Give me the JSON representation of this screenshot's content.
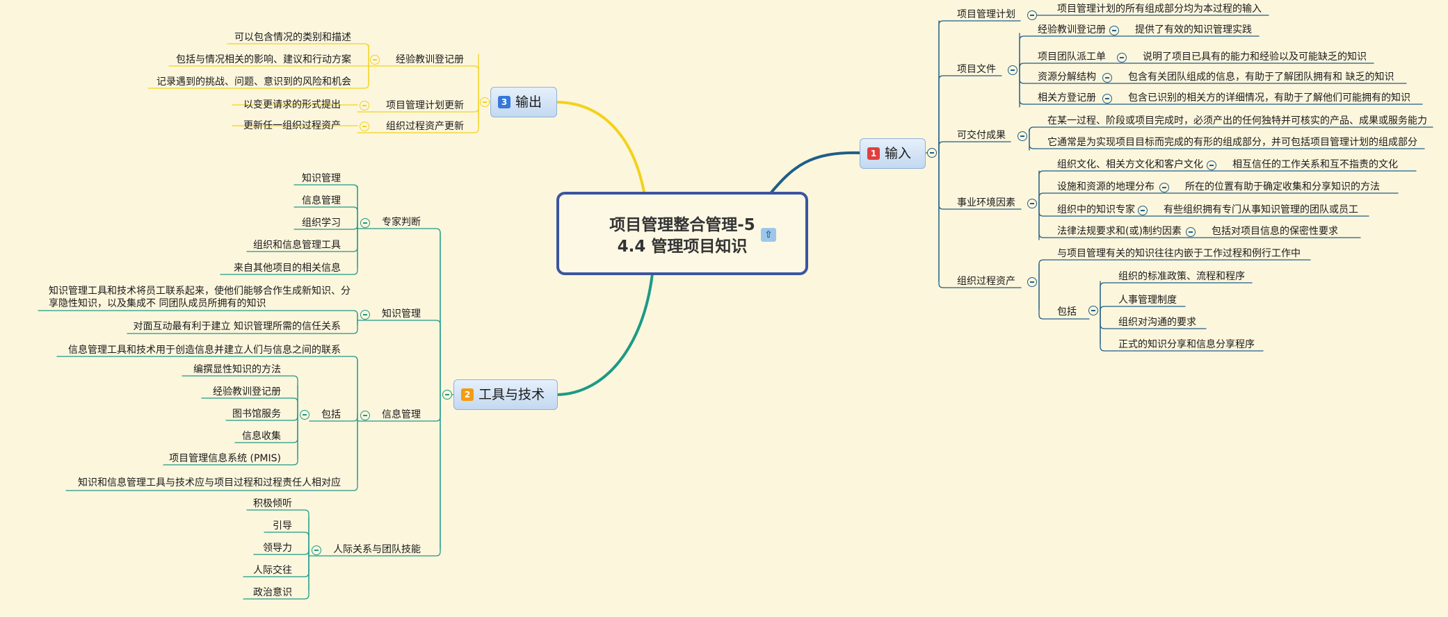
{
  "root": {
    "title_line1": "项目管理整合管理-5",
    "title_line2": "4.4 管理项目知识",
    "pin_icon": "pin-icon"
  },
  "branches": {
    "input": {
      "badge": "1",
      "label": "输入",
      "badge_color": "#e03f3f",
      "line_color": "#1f5e86"
    },
    "tools": {
      "badge": "2",
      "label": "工具与技术",
      "badge_color": "#f39c12",
      "line_color": "#1d9a86"
    },
    "output": {
      "badge": "3",
      "label": "输出",
      "badge_color": "#3478d8",
      "line_color": "#f2d21b"
    }
  },
  "input_items": {
    "plan": {
      "label": "项目管理计划",
      "child": "项目管理计划的所有组成部分均为本过程的输入"
    },
    "docs": {
      "label": "项目文件",
      "children": [
        {
          "label": "经验教训登记册",
          "desc": "提供了有效的知识管理实践"
        },
        {
          "label": "项目团队派工单",
          "desc": "说明了项目已具有的能力和经验以及可能缺乏的知识"
        },
        {
          "label": "资源分解结构",
          "desc": "包含有关团队组成的信息，有助于了解团队拥有和 缺乏的知识"
        },
        {
          "label": "相关方登记册",
          "desc": "包含已识别的相关方的详细情况，有助于了解他们可能拥有的知识"
        }
      ]
    },
    "deliverables": {
      "label": "可交付成果",
      "children": [
        "在某一过程、阶段或项目完成时，必须产出的任何独特并可核实的产品、成果或服务能力",
        "它通常是为实现项目目标而完成的有形的组成部分，并可包括项目管理计划的组成部分"
      ]
    },
    "eef": {
      "label": "事业环境因素",
      "children": [
        {
          "label": "组织文化、相关方文化和客户文化",
          "desc": "相互信任的工作关系和互不指责的文化"
        },
        {
          "label": "设施和资源的地理分布",
          "desc": "所在的位置有助于确定收集和分享知识的方法"
        },
        {
          "label": "组织中的知识专家",
          "desc": "有些组织拥有专门从事知识管理的团队或员工"
        },
        {
          "label": "法律法规要求和(或)制约因素",
          "desc": "包括对项目信息的保密性要求"
        }
      ]
    },
    "opa": {
      "label": "组织过程资产",
      "first": "与项目管理有关的知识往往内嵌于工作过程和例行工作中",
      "include_label": "包括",
      "include": [
        "组织的标准政策、流程和程序",
        "人事管理制度",
        "组织对沟通的要求",
        "正式的知识分享和信息分享程序"
      ]
    }
  },
  "tools_items": {
    "expert": {
      "label": "专家判断",
      "children": [
        "知识管理",
        "信息管理",
        "组织学习",
        "组织和信息管理工具",
        "来自其他项目的相关信息"
      ]
    },
    "km": {
      "label": "知识管理",
      "children": [
        "知识管理工具和技术将员工联系起来，使他们能够合作生成新知识、分享隐性知识，以及集成不 同团队成员所拥有的知识",
        "对面互动最有利于建立 知识管理所需的信任关系"
      ]
    },
    "im": {
      "label": "信息管理",
      "first": "信息管理工具和技术用于创造信息并建立人们与信息之间的联系",
      "include_label": "包括",
      "include": [
        "编撰显性知识的方法",
        "经验教训登记册",
        "图书馆服务",
        "信息收集",
        "项目管理信息系统 (PMIS)"
      ],
      "last": "知识和信息管理工具与技术应与项目过程和过程责任人相对应"
    },
    "ip": {
      "label": "人际关系与团队技能",
      "children": [
        "积极倾听",
        "引导",
        "领导力",
        "人际交往",
        "政治意识"
      ]
    }
  },
  "output_items": {
    "lessons": {
      "label": "经验教训登记册",
      "children": [
        "可以包含情况的类别和描述",
        "包括与情况相关的影响、建议和行动方案",
        "记录遇到的挑战、问题、意识到的风险和机会"
      ]
    },
    "pmp": {
      "label": "项目管理计划更新",
      "child": "以变更请求的形式提出"
    },
    "opa": {
      "label": "组织过程资产更新",
      "child": "更新任一组织过程资产"
    }
  }
}
